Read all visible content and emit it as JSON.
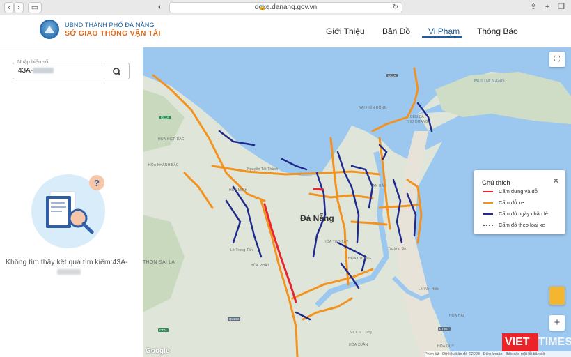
{
  "browser": {
    "url": "doxe.danang.gov.vn"
  },
  "header": {
    "org_line1": "UBND THÀNH PHỐ ĐÀ NẴNG",
    "org_line2": "SỞ GIAO THÔNG VẬN TẢI",
    "nav": [
      {
        "label": "Giới Thiệu",
        "active": false
      },
      {
        "label": "Bản Đồ",
        "active": false
      },
      {
        "label": "Vi Phạm",
        "active": true
      },
      {
        "label": "Thông Báo",
        "active": false
      }
    ]
  },
  "search": {
    "legend": "Nhập biển số",
    "value": "43A-"
  },
  "result": {
    "message": "Không tìm thấy kết quả tìm kiếm:43A-"
  },
  "map": {
    "city_label": "Đà Nẵng",
    "labels": {
      "ql1a": "QL1A",
      "ql14b": "QL14B",
      "dt607": "DT607",
      "ct01": "CT01",
      "mui_da_nang": "MUI DA NANG",
      "ben_ca": "BÉN CÁ",
      "tho_quang": "THỌ QUANG",
      "nai_hien_dong": "NẠI HIÊN ĐÔNG",
      "hoa_hiep_bac": "HÒA HIỆP BẮC",
      "hoa_khanh_bac": "HÒA KHÁNH BẮC",
      "hoa_minh": "HÒA MINH",
      "hoa_phat": "HÒA PHÁT",
      "hoa_cuong": "HÒA CƯỜNG",
      "hoa_xuan": "HÒA XUÂN",
      "hoa_quy": "HÒA QUÝ",
      "thon_dai_la": "THÔN ĐẠI LA",
      "hoa_hai": "HOA HẢI",
      "hoa_tho_tay": "HÒA THỌ TÂY",
      "an_hai": "AN HẢI",
      "nguyen_tat_thanh": "Nguyễn Tất Thành",
      "vo_chi_cong": "Võ Chí Công",
      "le_van_hien": "Lê Văn Hiến",
      "truong_sa": "Trường Sa",
      "le_trong_tan": "Lê Trọng Tấn"
    },
    "footer": {
      "shortcuts": "Phím tắt",
      "data": "Dữ liệu bản đồ ©2023",
      "terms": "Điều khoản",
      "report": "Báo cáo một lỗi bản đồ"
    },
    "watermark_brand": "VIETTIMES",
    "google": "Google"
  },
  "legend": {
    "title": "Chú thích",
    "items": [
      {
        "label": "Cấm dừng và đỗ",
        "color": "#e8252c",
        "style": "solid"
      },
      {
        "label": "Cấm đỗ xe",
        "color": "#f2921f",
        "style": "solid"
      },
      {
        "label": "Cấm đỗ ngày chẵn lẻ",
        "color": "#1f2a8c",
        "style": "solid"
      },
      {
        "label": "Cấm đỗ theo loại xe",
        "color": "#555555",
        "style": "dotted"
      }
    ]
  },
  "colors": {
    "brand_blue": "#1b5f9e",
    "brand_orange": "#e06a1a",
    "water": "#9cc7ee"
  }
}
